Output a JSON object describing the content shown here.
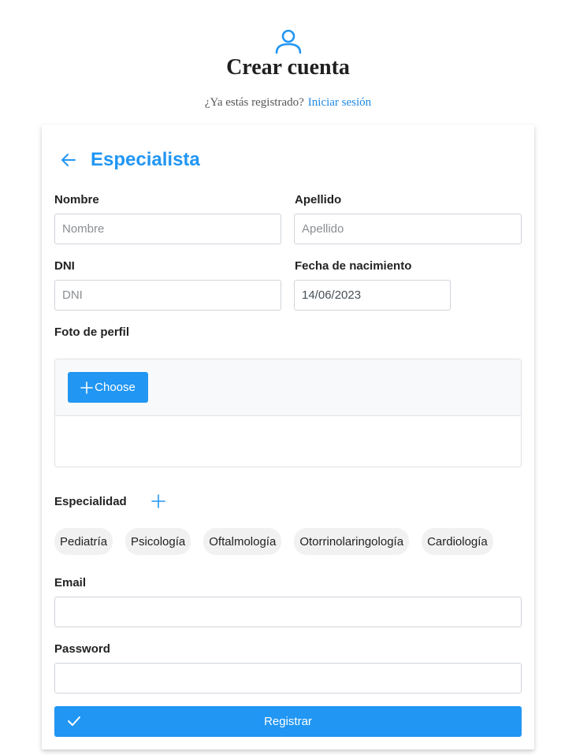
{
  "header": {
    "icon": "user-icon",
    "title": "Crear cuenta",
    "subtitle": "¿Ya estás registrado?",
    "login_link": "Iniciar sesión"
  },
  "form": {
    "back_icon": "arrow-left-icon",
    "title": "Especialista",
    "nombre": {
      "label": "Nombre",
      "placeholder": "Nombre",
      "value": ""
    },
    "apellido": {
      "label": "Apellido",
      "placeholder": "Apellido",
      "value": ""
    },
    "dni": {
      "label": "DNI",
      "placeholder": "DNI",
      "value": ""
    },
    "fecha": {
      "label": "Fecha de nacimiento",
      "value": "14/06/2023"
    },
    "foto": {
      "label": "Foto de perfil",
      "choose_label": "Choose"
    },
    "especialidad": {
      "label": "Especialidad",
      "options": [
        "Pediatría",
        "Psicología",
        "Oftalmología",
        "Otorrinolaringología",
        "Cardiología"
      ]
    },
    "email": {
      "label": "Email",
      "value": ""
    },
    "password": {
      "label": "Password",
      "value": ""
    },
    "submit_label": "Registrar"
  },
  "colors": {
    "accent": "#2196F3",
    "link": "#1E88E5"
  }
}
